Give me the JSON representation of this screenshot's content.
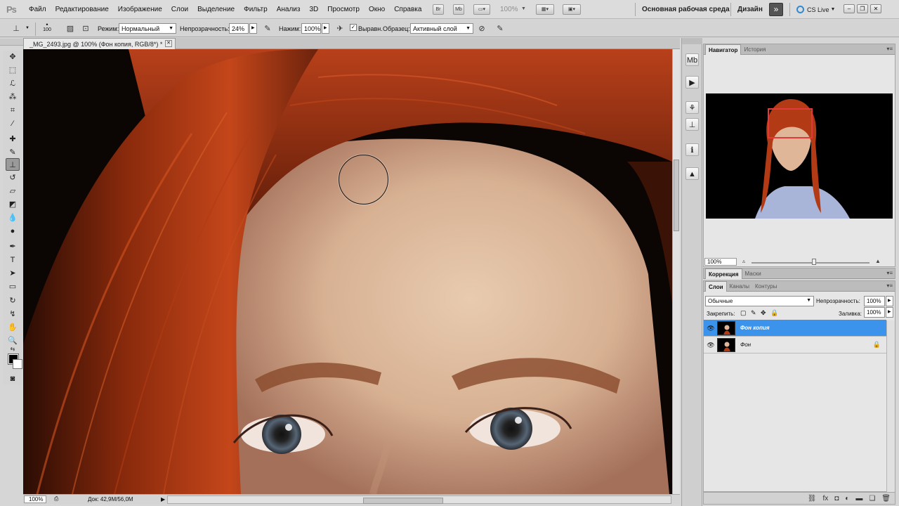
{
  "menubar": {
    "logo": "Ps",
    "items": [
      "Файл",
      "Редактирование",
      "Изображение",
      "Слои",
      "Выделение",
      "Фильтр",
      "Анализ",
      "3D",
      "Просмотр",
      "Окно",
      "Справка"
    ],
    "bridge_label": "Br",
    "minibridge_label": "Mb",
    "zoom_readout": "100%",
    "workspace_label": "Основная рабочая среда",
    "design_label": "Дизайн",
    "more_label": "»",
    "cslive_label": "CS Live",
    "minimize": "–",
    "restore": "❐",
    "close": "✕"
  },
  "options": {
    "brush_size": "100",
    "mode_label": "Режим:",
    "mode_value": "Нормальный",
    "opacity_label": "Непрозрачность:",
    "opacity_value": "24%",
    "flow_label": "Нажим:",
    "flow_value": "100%",
    "aligned_label": "Выравн.",
    "aligned_checked": "✓",
    "sample_label": "Образец:",
    "sample_value": "Активный слой"
  },
  "document": {
    "tab_title": "_MG_2493.jpg @ 100% (Фон копия, RGB/8*) *",
    "tab_close": "✕"
  },
  "status": {
    "zoom": "100%",
    "doc_info": "Док: 42,9M/56,0M",
    "arrow": "▶"
  },
  "navigator": {
    "tabs": [
      "Навигатор",
      "История"
    ],
    "zoom": "100%",
    "menu": "▾≡"
  },
  "adjustments": {
    "tabs": [
      "Коррекция",
      "Маски"
    ],
    "menu": "▾≡"
  },
  "layers_panel": {
    "tabs": [
      "Слои",
      "Каналы",
      "Контуры"
    ],
    "menu": "▾≡",
    "blend_mode": "Обычные",
    "opacity_label": "Непрозрачность:",
    "opacity_value": "100%",
    "lock_label": "Закрепить:",
    "fill_label": "Заливка:",
    "fill_value": "100%",
    "layers": [
      {
        "name": "Фон копия",
        "active": true
      },
      {
        "name": "Фон",
        "locked": true
      }
    ]
  },
  "colors": {
    "accent": "#3b93ec",
    "nav_frame": "#e03a3a",
    "foreground": "#000000",
    "background": "#ffffff"
  },
  "icons": {
    "toolbox": [
      "move-icon",
      "marquee-icon",
      "lasso-icon",
      "quick-select-icon",
      "crop-icon",
      "eyedropper-icon",
      "spot-heal-icon",
      "brush-icon",
      "clone-stamp-icon",
      "history-brush-icon",
      "eraser-icon",
      "gradient-icon",
      "blur-icon",
      "dodge-icon",
      "pen-icon",
      "type-icon",
      "path-select-icon",
      "shape-icon",
      "3d-rotate-icon",
      "3d-orbit-icon",
      "hand-icon",
      "zoom-icon"
    ]
  }
}
